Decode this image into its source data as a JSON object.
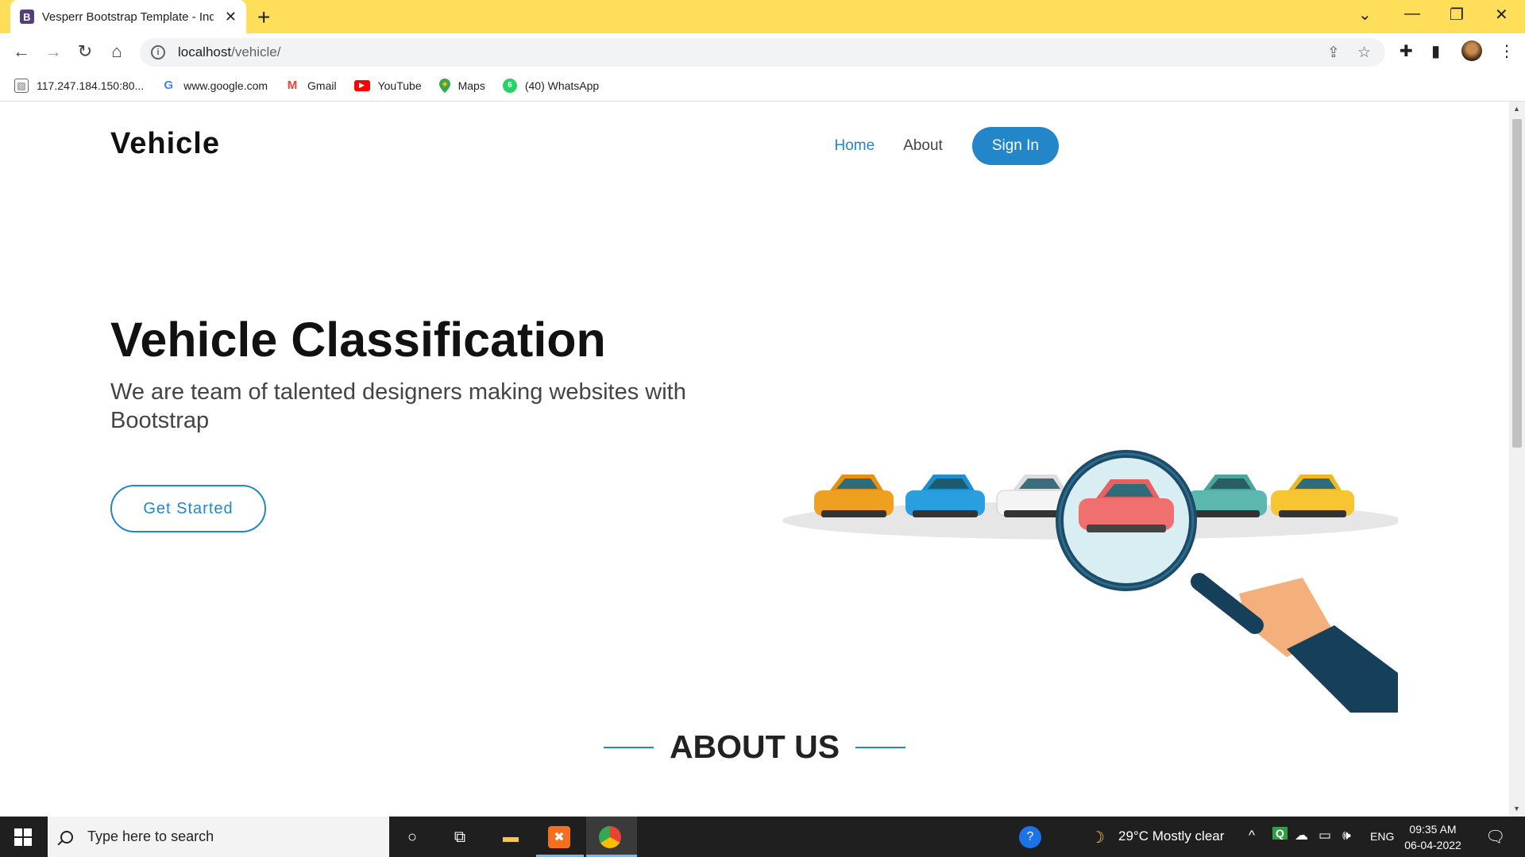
{
  "browser": {
    "tab_title": "Vesperr Bootstrap Template - Ind",
    "tab_favicon_letter": "B",
    "url_host": "localhost",
    "url_path": "/vehicle/",
    "bookmarks": [
      {
        "label": "117.247.184.150:80...",
        "icon": "broken-image-icon"
      },
      {
        "label": "www.google.com",
        "icon": "google-icon"
      },
      {
        "label": "Gmail",
        "icon": "gmail-icon"
      },
      {
        "label": "YouTube",
        "icon": "youtube-icon"
      },
      {
        "label": "Maps",
        "icon": "maps-icon"
      },
      {
        "label": "(40) WhatsApp",
        "icon": "whatsapp-icon"
      }
    ]
  },
  "site": {
    "logo": "Vehicle",
    "nav": {
      "home": "Home",
      "about": "About",
      "signin": "Sign In"
    },
    "hero": {
      "title": "Vehicle Classification",
      "subtitle": "We are team of talented designers making websites with Bootstrap",
      "cta": "Get Started"
    },
    "about_heading": "ABOUT US",
    "accent_color": "#2386c8"
  },
  "taskbar": {
    "search_placeholder": "Type here to search",
    "weather": "29°C  Mostly clear",
    "language": "ENG",
    "time": "09:35 AM",
    "date": "06-04-2022"
  }
}
